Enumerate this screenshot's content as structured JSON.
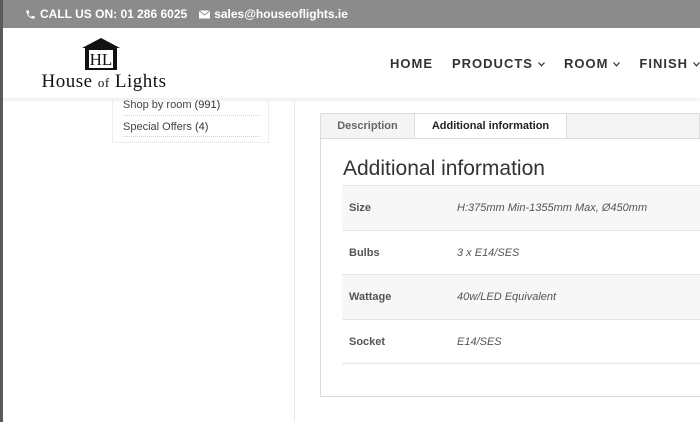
{
  "topbar": {
    "phone_label": "CALL US ON: 01 286 6025",
    "email_label": "sales@houseoflights.ie"
  },
  "logo": {
    "monogram": "HL",
    "name_house": "House",
    "name_of": "of",
    "name_lights": "Lights"
  },
  "nav": {
    "items": [
      {
        "label": "HOME",
        "has_dropdown": false
      },
      {
        "label": "PRODUCTS",
        "has_dropdown": true
      },
      {
        "label": "ROOM",
        "has_dropdown": true
      },
      {
        "label": "FINISH",
        "has_dropdown": true
      }
    ]
  },
  "sidebar": {
    "links": [
      {
        "label": "Shop by room",
        "count": "(991)"
      },
      {
        "label": "Special Offers",
        "count": "(4)"
      }
    ]
  },
  "tabs": [
    {
      "label": "Description",
      "active": false
    },
    {
      "label": "Additional information",
      "active": true
    }
  ],
  "panel": {
    "title": "Additional information",
    "rows": [
      {
        "key": "Size",
        "value": "H:375mm Min-1355mm Max, Ø450mm"
      },
      {
        "key": "Bulbs",
        "value": "3 x E14/SES"
      },
      {
        "key": "Wattage",
        "value": "40w/LED Equivalent"
      },
      {
        "key": "Socket",
        "value": "E14/SES"
      }
    ]
  },
  "colors": {
    "topbar_bg": "#8b8b8b",
    "frame": "#5a5a5a",
    "text": "#444444"
  }
}
